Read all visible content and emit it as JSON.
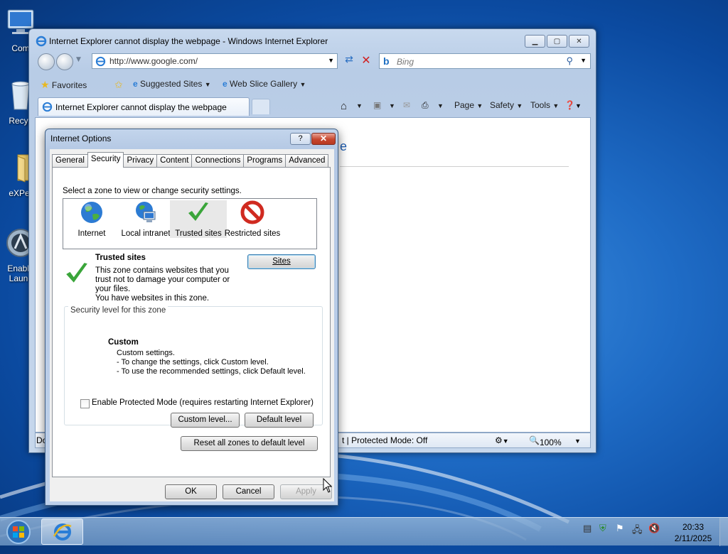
{
  "desktop": {
    "icons": [
      {
        "label": "Com"
      },
      {
        "label": "Recyc"
      },
      {
        "label": "eXPer"
      },
      {
        "label": "Enable",
        "label2": "Launc"
      }
    ]
  },
  "ie": {
    "title": "Internet Explorer cannot display the webpage - Windows Internet Explorer",
    "address": "http://www.google.com/",
    "search_placeholder": "Bing",
    "favorites_label": "Favorites",
    "suggested_sites": "Suggested Sites",
    "web_slice_gallery": "Web Slice Gallery",
    "tab_title": "Internet Explorer cannot display the webpage",
    "menu_page": "Page",
    "menu_safety": "Safety",
    "menu_tools": "Tools",
    "content_fragment": "e",
    "status_left": "Do",
    "status_mode": "t | Protected Mode: Off",
    "zoom": "100%"
  },
  "dialog": {
    "title": "Internet Options",
    "help_label": "?",
    "tabs": [
      "General",
      "Security",
      "Privacy",
      "Content",
      "Connections",
      "Programs",
      "Advanced"
    ],
    "instruction": "Select a zone to view or change security settings.",
    "zones": [
      "Internet",
      "Local intranet",
      "Trusted sites",
      "Restricted sites"
    ],
    "zone_title": "Trusted sites",
    "zone_desc": "This zone contains websites that you trust not to damage your computer or your files.",
    "zone_note": "You have websites in this zone.",
    "sites_button": "Sites",
    "level_legend": "Security level for this zone",
    "level_name": "Custom",
    "level_lines": [
      "Custom settings.",
      "- To change the settings, click Custom level.",
      "- To use the recommended settings, click Default level."
    ],
    "protected_mode": "Enable Protected Mode (requires restarting Internet Explorer)",
    "protected_mode_checked": false,
    "custom_level_button": "Custom level...",
    "default_level_button": "Default level",
    "reset_button": "Reset all zones to default level",
    "ok_button": "OK",
    "cancel_button": "Cancel",
    "apply_button": "Apply"
  },
  "taskbar": {
    "time": "20:33",
    "date": "2/11/2025"
  },
  "colors": {
    "desktop_blue": "#1f6cc6",
    "close_red": "#c6462e",
    "check_green": "#3aa53a"
  }
}
